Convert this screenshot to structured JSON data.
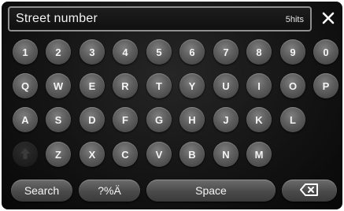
{
  "search": {
    "value": "Street number",
    "hits": "5hits"
  },
  "close_icon": "close-icon",
  "keyboard": {
    "row1": [
      "1",
      "2",
      "3",
      "4",
      "5",
      "6",
      "7",
      "8",
      "9",
      "0"
    ],
    "row2": [
      "Q",
      "W",
      "E",
      "R",
      "T",
      "Y",
      "U",
      "I",
      "O",
      "P"
    ],
    "row3": [
      "A",
      "S",
      "D",
      "F",
      "G",
      "H",
      "J",
      "K",
      "L"
    ],
    "row4": [
      "Z",
      "X",
      "C",
      "V",
      "B",
      "N",
      "M"
    ],
    "shift_icon": "shift-up-arrow-icon"
  },
  "bottom": {
    "search_label": "Search",
    "symbols_label": "?%Ä",
    "space_label": "Space",
    "backspace_icon": "backspace-icon"
  },
  "colors": {
    "background": "#141414",
    "key": "#5c5c5c",
    "text": "#f4f4f4",
    "field_border": "#8f8f8f"
  }
}
